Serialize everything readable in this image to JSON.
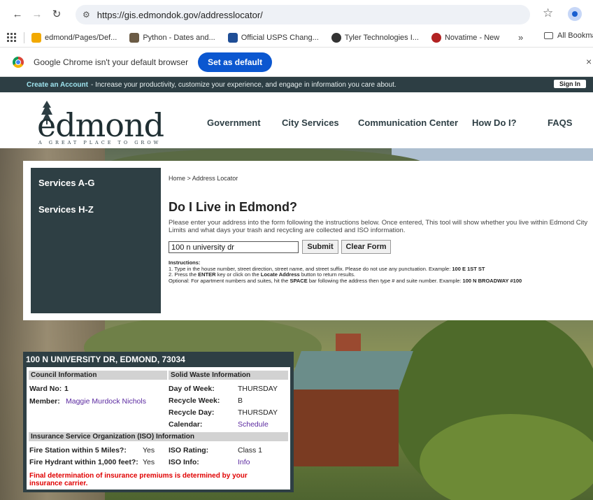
{
  "browser": {
    "url": "https://gis.edmondok.gov/addresslocator/",
    "bookmarks": [
      {
        "label": "edmond/Pages/Def...",
        "color": "#f2a900"
      },
      {
        "label": "Python - Dates and...",
        "color": "#6b5b45"
      },
      {
        "label": "Official USPS Chang...",
        "color": "#1f4e96"
      },
      {
        "label": "Tyler Technologies I...",
        "color": "#333333"
      },
      {
        "label": "Novatime - New",
        "color": "#b22222"
      }
    ],
    "more_bookmarks": "»",
    "all_bookmarks": "All Bookmar",
    "info_text": "Google Chrome isn't your default browser",
    "set_default": "Set as default",
    "close": "×"
  },
  "site": {
    "create_account": "Create an Account",
    "account_tagline": "- Increase your productivity, customize your experience, and engage in information you care about.",
    "sign_in": "Sign In",
    "logo_word": "edmond",
    "logo_tag": "A GREAT PLACE TO GROW",
    "nav": [
      "Government",
      "City Services",
      "Communication Center",
      "How Do I?",
      "FAQS"
    ]
  },
  "sidebar": {
    "items": [
      "Services A-G",
      "Services H-Z"
    ]
  },
  "main": {
    "breadcrumb": "Home  >  Address Locator",
    "title": "Do I Live in Edmond?",
    "description": "Please enter your address into the form following the instructions below. Once entered, This tool will show whether you live within Edmond City Limits and what days your trash and recycling are collected and ISO information.",
    "address_value": "100 n university dr",
    "submit": "Submit",
    "clear": "Clear Form",
    "instructions_title": "Instructions:",
    "instr1_a": "1. Type in the house number, street direction, street name, and street suffix. Please do not use any punctuation. Example: ",
    "instr1_b": "100 E 1ST ST",
    "instr2_a": "2. Press the ",
    "instr2_b": "ENTER",
    "instr2_c": " key or click on the ",
    "instr2_d": "Locate Address",
    "instr2_e": " button to return results.",
    "instr3_a": "Optional: For apartment numbers and suites, hit the ",
    "instr3_b": "SPACE",
    "instr3_c": " bar following the address then type # and suite number. Example: ",
    "instr3_d": "100 N BROADWAY #100"
  },
  "result": {
    "address": "100 N UNIVERSITY DR, EDMOND, 73034",
    "council_header": "Council Information",
    "ward_label": "Ward No:",
    "ward_value": "1",
    "member_label": "Member:",
    "member_value": "Maggie Murdock Nichols",
    "waste_header": "Solid Waste Information",
    "day_label": "Day of Week:",
    "day_value": "THURSDAY",
    "recycle_week_label": "Recycle Week:",
    "recycle_week_value": "B",
    "recycle_day_label": "Recycle Day:",
    "recycle_day_value": "THURSDAY",
    "calendar_label": "Calendar:",
    "calendar_value": "Schedule",
    "iso_header": "Insurance Service Organization (ISO) Information",
    "fire_station_label": "Fire Station within 5 Miles?:",
    "fire_station_value": "Yes",
    "hydrant_label": "Fire Hydrant within 1,000 feet?:",
    "hydrant_value": "Yes",
    "iso_rating_label": "ISO Rating:",
    "iso_rating_value": "Class 1",
    "iso_info_label": "ISO Info:",
    "iso_info_value": "Info",
    "disclaimer": "Final determination of insurance premiums is determined by your insurance carrier."
  }
}
